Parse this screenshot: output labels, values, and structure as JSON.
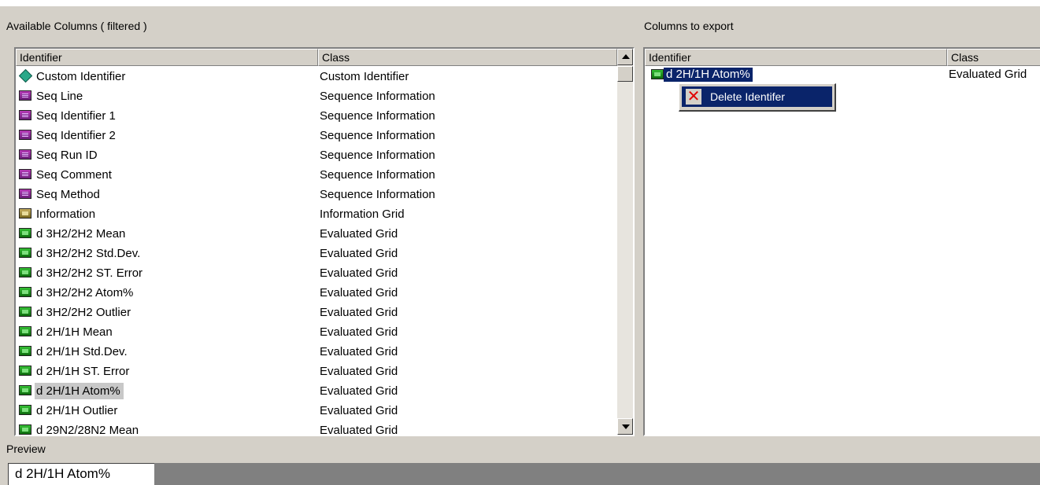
{
  "available": {
    "title": "Available Columns ( filtered )",
    "columns": {
      "identifier": "Identifier",
      "class": "Class"
    },
    "rows": [
      {
        "icon": "diamond-icon",
        "identifier": "Custom Identifier",
        "class": "Custom Identifier"
      },
      {
        "icon": "purple-grid-icon",
        "identifier": "Seq Line",
        "class": "Sequence Information"
      },
      {
        "icon": "purple-grid-icon",
        "identifier": "Seq Identifier 1",
        "class": "Sequence Information"
      },
      {
        "icon": "purple-grid-icon",
        "identifier": "Seq Identifier 2",
        "class": "Sequence Information"
      },
      {
        "icon": "purple-grid-icon",
        "identifier": "Seq Run ID",
        "class": "Sequence Information"
      },
      {
        "icon": "purple-grid-icon",
        "identifier": "Seq Comment",
        "class": "Sequence Information"
      },
      {
        "icon": "purple-grid-icon",
        "identifier": "Seq Method",
        "class": "Sequence Information"
      },
      {
        "icon": "olive-grid-icon",
        "identifier": "Information",
        "class": "Information Grid"
      },
      {
        "icon": "green-grid-icon",
        "identifier": "d  3H2/2H2  Mean",
        "class": "Evaluated Grid"
      },
      {
        "icon": "green-grid-icon",
        "identifier": "d  3H2/2H2  Std.Dev.",
        "class": "Evaluated Grid"
      },
      {
        "icon": "green-grid-icon",
        "identifier": "d  3H2/2H2  ST. Error",
        "class": "Evaluated Grid"
      },
      {
        "icon": "green-grid-icon",
        "identifier": "d  3H2/2H2 Atom%",
        "class": "Evaluated Grid"
      },
      {
        "icon": "green-grid-icon",
        "identifier": "d  3H2/2H2 Outlier",
        "class": "Evaluated Grid"
      },
      {
        "icon": "green-grid-icon",
        "identifier": "d  2H/1H  Mean",
        "class": "Evaluated Grid"
      },
      {
        "icon": "green-grid-icon",
        "identifier": "d  2H/1H  Std.Dev.",
        "class": "Evaluated Grid"
      },
      {
        "icon": "green-grid-icon",
        "identifier": "d  2H/1H  ST. Error",
        "class": "Evaluated Grid"
      },
      {
        "icon": "green-grid-icon",
        "identifier": "d  2H/1H Atom%",
        "class": "Evaluated Grid",
        "highlighted": true
      },
      {
        "icon": "green-grid-icon",
        "identifier": "d  2H/1H Outlier",
        "class": "Evaluated Grid"
      },
      {
        "icon": "green-grid-icon",
        "identifier": "d  29N2/28N2  Mean",
        "class": "Evaluated Grid"
      }
    ]
  },
  "export": {
    "title": "Columns to export",
    "columns": {
      "identifier": "Identifier",
      "class": "Class"
    },
    "rows": [
      {
        "icon": "green-grid-icon",
        "identifier": "d  2H/1H Atom%",
        "class": "Evaluated Grid",
        "selected": true
      }
    ]
  },
  "context_menu": {
    "icon": "red-x-icon",
    "label": "Delete Identifer"
  },
  "preview": {
    "label": "Preview",
    "value": "d  2H/1H Atom%"
  }
}
